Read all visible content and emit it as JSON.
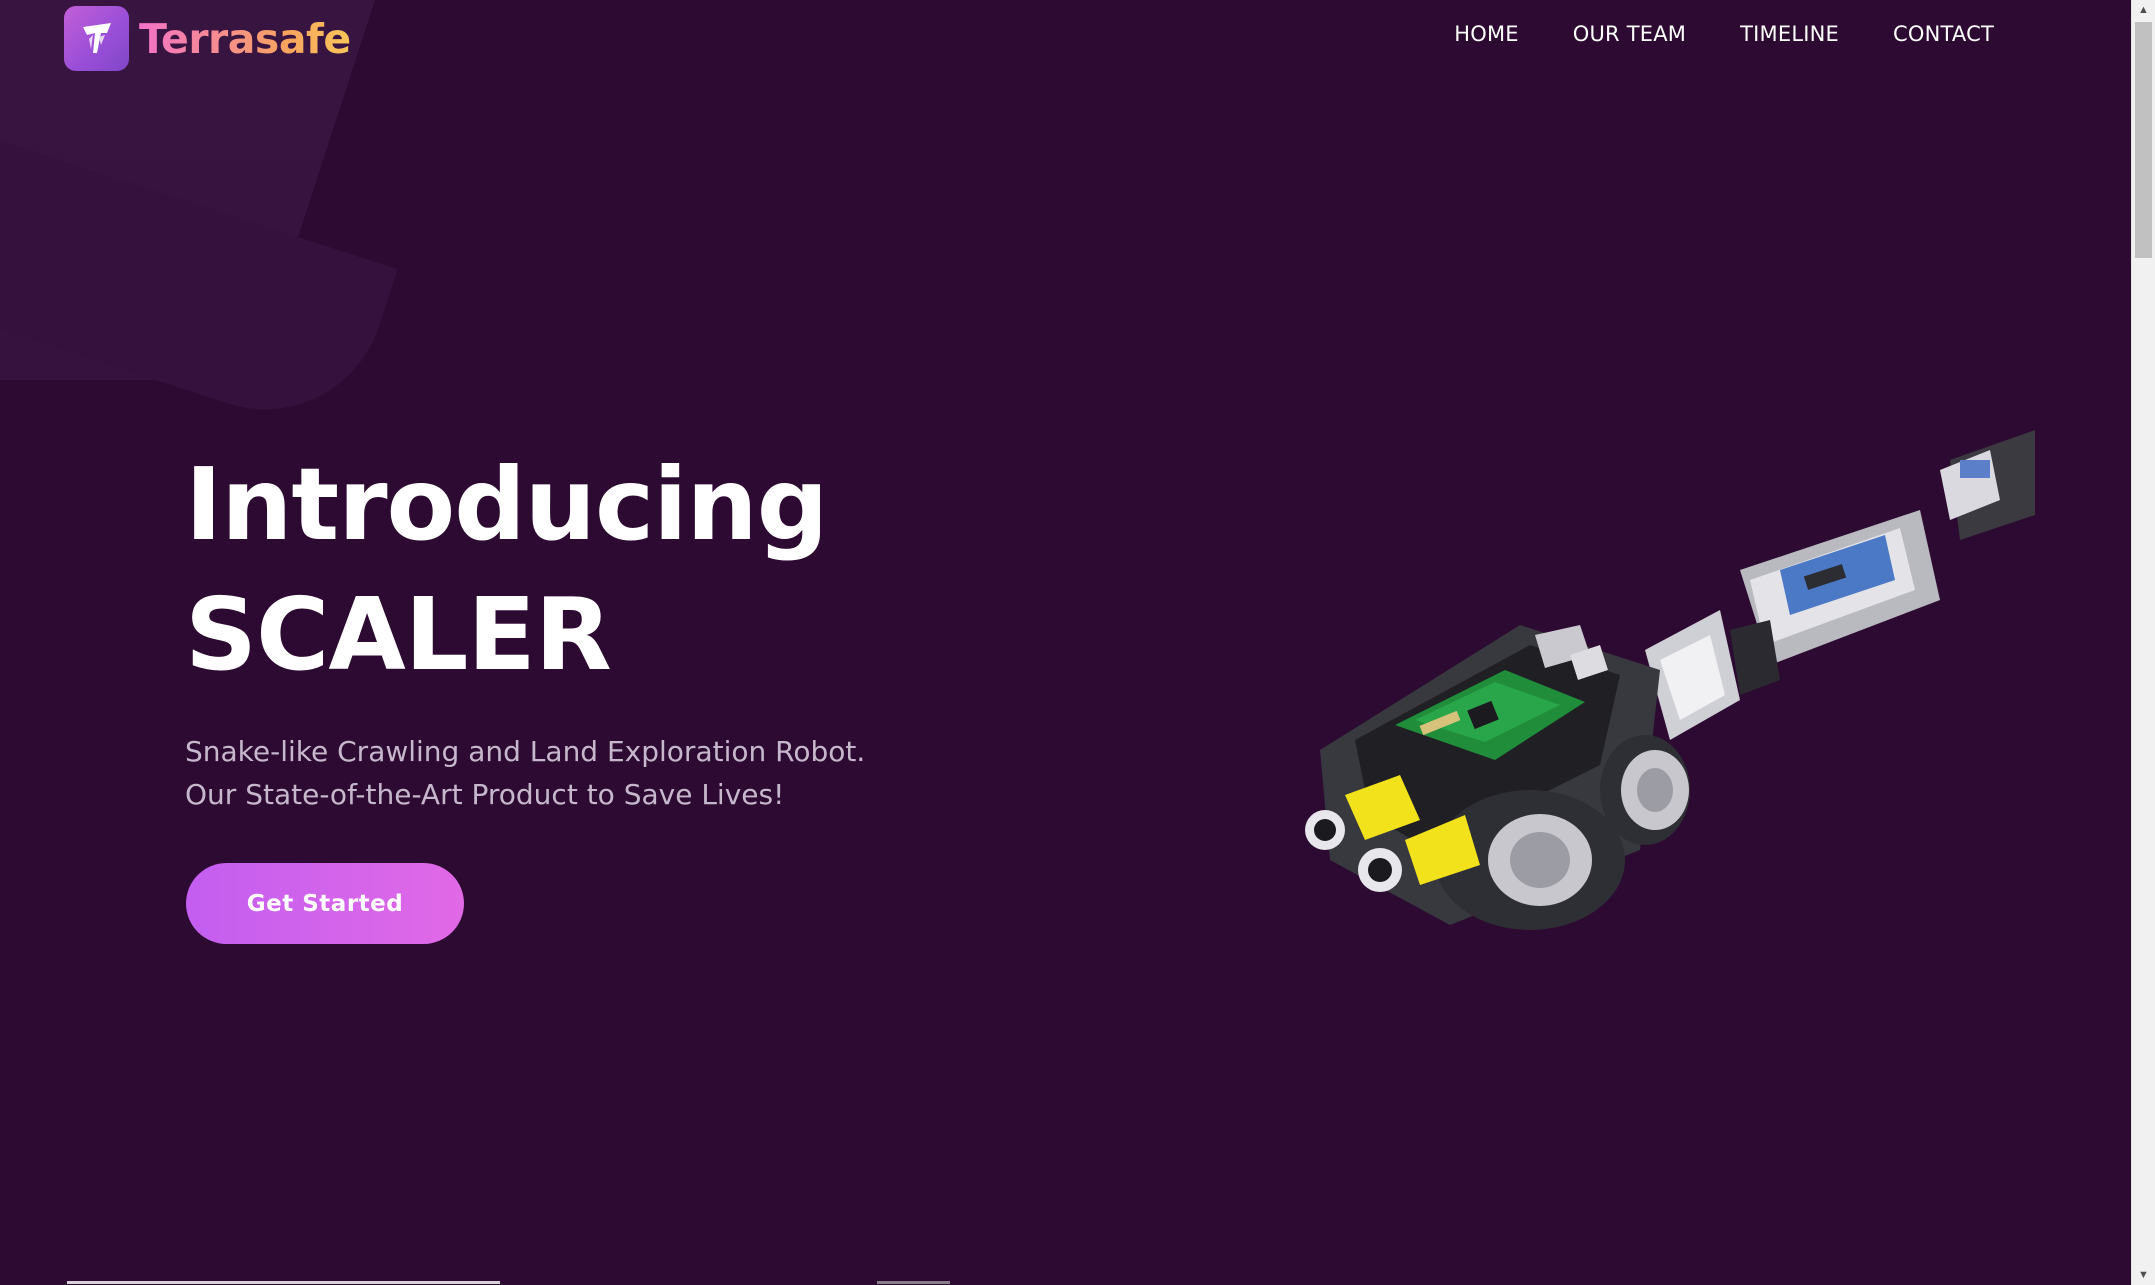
{
  "brand": {
    "name": "Terrasafe",
    "logo_icon": "shield-t-icon"
  },
  "nav": {
    "items": [
      {
        "label": "HOME"
      },
      {
        "label": "OUR TEAM"
      },
      {
        "label": "TIMELINE"
      },
      {
        "label": "CONTACT"
      }
    ]
  },
  "hero": {
    "title_line1": "Introducing",
    "title_line2": "SCALER",
    "subtitle": "Snake-like Crawling and Land Exploration Robot. Our State-of-the-Art Product to Save Lives!",
    "cta_label": "Get Started",
    "image": "snake-robot-illustration"
  },
  "colors": {
    "background": "#2d0a31",
    "accent_start": "#c35ef0",
    "accent_end": "#e169e6",
    "brand_gradient_start": "#f472c9",
    "brand_gradient_end": "#f8c65a"
  }
}
